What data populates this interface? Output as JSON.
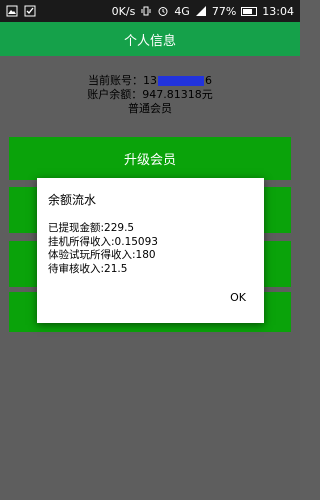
{
  "status_bar": {
    "net_speed": "0K/s",
    "network": "4G",
    "battery": "77%",
    "time": "13:04"
  },
  "header": {
    "title": "个人信息"
  },
  "account": {
    "phone_label": "当前账号：",
    "phone_prefix": "13",
    "phone_suffix": "6",
    "balance_label": "账户余额：",
    "balance_value": "947.81318元",
    "member_level": "普通会员"
  },
  "buttons": {
    "upgrade_label": "升级会员"
  },
  "dialog": {
    "title": "余额流水",
    "rows": [
      {
        "label": "已提现金额:",
        "value": "229.5"
      },
      {
        "label": "挂机所得收入:",
        "value": "0.15093"
      },
      {
        "label": "体验试玩所得收入:",
        "value": "180"
      },
      {
        "label": "待审核收入:",
        "value": "21.5"
      }
    ],
    "ok_label": "OK"
  }
}
